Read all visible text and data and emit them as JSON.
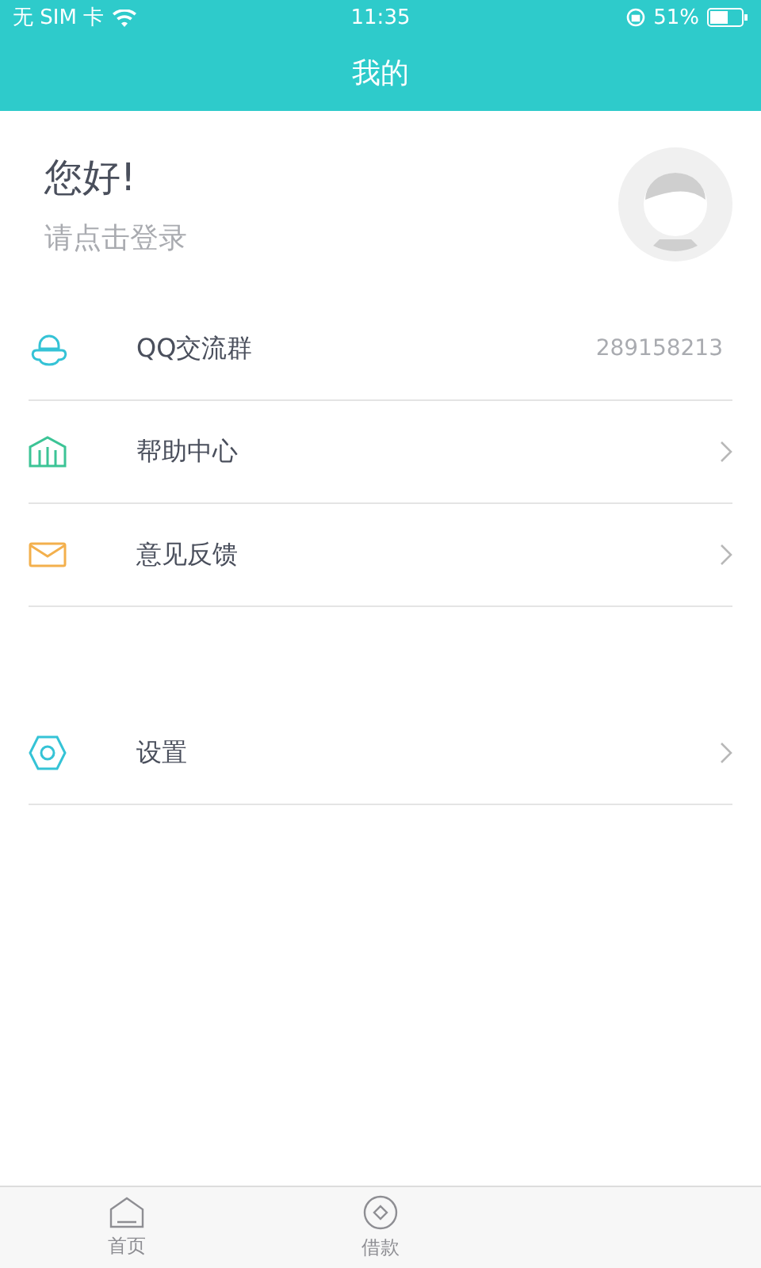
{
  "status_bar": {
    "carrier": "无 SIM 卡",
    "time": "11:35",
    "battery": "51%"
  },
  "nav": {
    "title": "我的"
  },
  "profile": {
    "greeting": "您好!",
    "prompt": "请点击登录"
  },
  "menu_groups": [
    [
      {
        "kind": "value",
        "label": "QQ交流群",
        "value": "289158213"
      },
      {
        "kind": "link",
        "label": "帮助中心"
      },
      {
        "kind": "link",
        "label": "意见反馈"
      }
    ],
    [
      {
        "kind": "link",
        "label": "设置"
      }
    ]
  ],
  "tab_bar": [
    {
      "label": "首页",
      "selected": false
    },
    {
      "label": "借款",
      "selected": false
    }
  ]
}
